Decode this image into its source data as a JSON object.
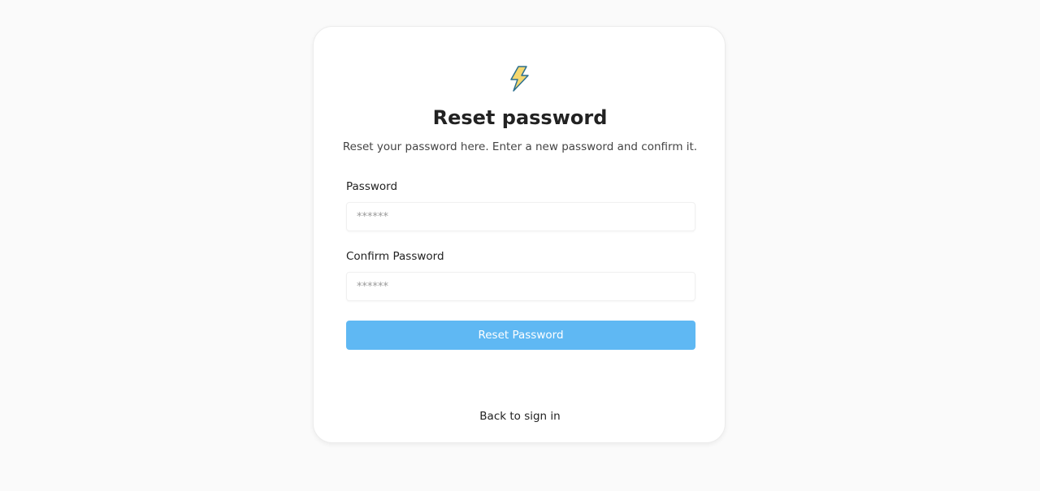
{
  "brand": {
    "logo_icon": "lightning-bolt-icon",
    "logo_fill": "#f5d76e",
    "logo_stroke": "#2b6f8f"
  },
  "header": {
    "title": "Reset password",
    "subtitle": "Reset your password here. Enter a new password and confirm it."
  },
  "form": {
    "password_label": "Password",
    "password_placeholder": "******",
    "password_value": "",
    "confirm_label": "Confirm Password",
    "confirm_placeholder": "******",
    "confirm_value": "",
    "submit_label": "Reset Password"
  },
  "footer": {
    "back_link": "Back to sign in"
  },
  "colors": {
    "accent": "#5fb8f3",
    "background": "#fafafa",
    "card": "#ffffff"
  }
}
